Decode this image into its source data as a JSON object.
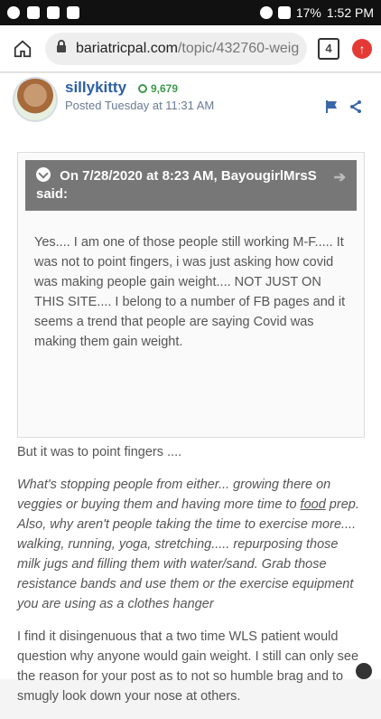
{
  "statusbar": {
    "battery": "17%",
    "time": "1:52 PM"
  },
  "browser": {
    "url_domain": "bariatricpal.com",
    "url_path": "/topic/432760-weig",
    "tabs_count": "4"
  },
  "post": {
    "author": "sillykitty",
    "reputation": "9,679",
    "posted": "Posted Tuesday at 11:31 AM",
    "quote": {
      "header": "On 7/28/2020 at 8:23 AM, BayougirlMrsS said:",
      "text": "Yes.... I am one of those people still working M-F..... It was not to point fingers, i was just asking how covid was making people gain weight.... NOT JUST ON THIS SITE.... I belong to a number of FB pages and it seems a trend that people are saying Covid was making them gain weight."
    },
    "paragraphs": [
      "But it was to point fingers ....",
      "What's stopping people from either... growing there on veggies or buying them and having more time to ",
      "food",
      " prep. Also, why aren't people taking the time to exercise more.... walking, running, yoga, stretching..... repurposing those milk jugs and filling them with water/sand. Grab those resistance bands and use them or the exercise equipment you are using as a clothes hanger",
      "I find it disingenuous that a two time WLS patient would question why anyone would gain weight. I still can only see the reason for your post as to not so humble brag and to smugly look down your nose at others."
    ]
  }
}
